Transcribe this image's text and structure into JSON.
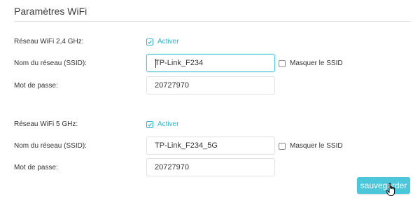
{
  "header": {
    "title": "Paramètres WiFi"
  },
  "band_24": {
    "label": "Réseau WiFi 2,4 GHz:",
    "enable_label": "Activer",
    "enabled": true,
    "ssid_label": "Nom du réseau (SSID):",
    "ssid_value": "TP-Link_F234",
    "hide_ssid_label": "Masquer le SSID",
    "password_label": "Mot de passe:",
    "password_value": "20727970"
  },
  "band_5": {
    "label": "Réseau WiFi 5 GHz:",
    "enable_label": "Activer",
    "enabled": true,
    "ssid_label": "Nom du réseau (SSID):",
    "ssid_value": "TP-Link_F234_5G",
    "hide_ssid_label": "Masquer le SSID",
    "password_label": "Mot de passe:",
    "password_value": "20727970"
  },
  "actions": {
    "save_label": "sauvegarder"
  },
  "colors": {
    "accent": "#4cc6da",
    "check": "#2bb8cf"
  }
}
